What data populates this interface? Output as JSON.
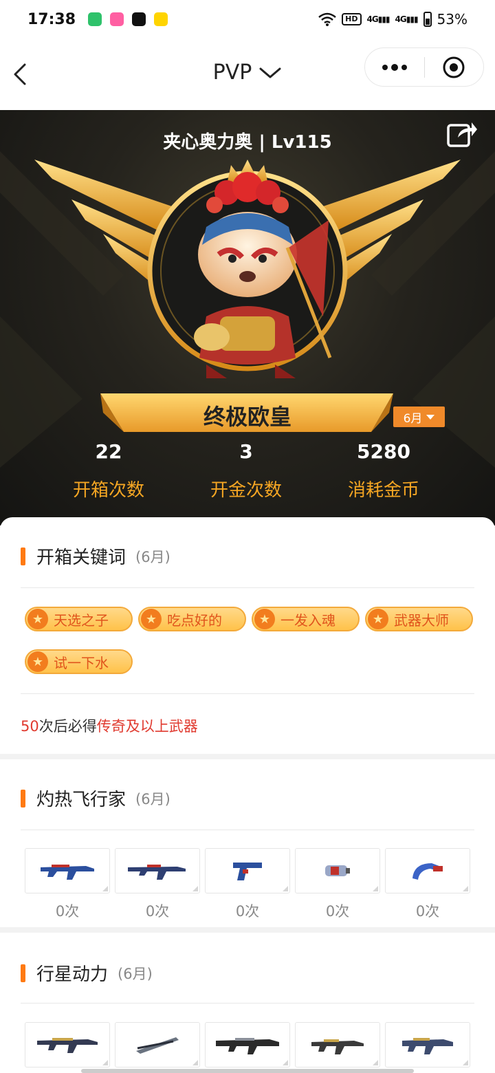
{
  "status_bar": {
    "time": "17:38",
    "hd_label": "HD",
    "signal_1": "4G",
    "signal_2": "4G",
    "battery": "53%",
    "app_icon_colors": [
      "#2fc26b",
      "#ff5fa2",
      "#111111",
      "#ffd400"
    ]
  },
  "nav": {
    "title": "PVP"
  },
  "hero": {
    "player_title": "夹心奥力奥 | Lv115",
    "rank_title": "终极欧皇",
    "month_selector": "6月",
    "stats": [
      {
        "value": "22",
        "label": "开箱次数"
      },
      {
        "value": "3",
        "label": "开金次数"
      },
      {
        "value": "5280",
        "label": "消耗金币"
      }
    ]
  },
  "keywords_section": {
    "title": "开箱关键词",
    "period": "(6月)",
    "tags": [
      "天选之子",
      "吃点好的",
      "一发入魂",
      "武器大师",
      "试一下水"
    ],
    "guarantee_count": "50",
    "guarantee_mid": "次后必得",
    "guarantee_target": "传奇及以上武器"
  },
  "sections": [
    {
      "title": "灼热飞行家",
      "period": "(6月)",
      "items": [
        {
          "icon": "rifle-icon",
          "count": "0次"
        },
        {
          "icon": "rifle-icon",
          "count": "0次"
        },
        {
          "icon": "pistol-icon",
          "count": "0次"
        },
        {
          "icon": "grenade-icon",
          "count": "0次"
        },
        {
          "icon": "karambit-icon",
          "count": "0次"
        }
      ]
    },
    {
      "title": "行星动力",
      "period": "(6月)",
      "items": [
        {
          "icon": "rifle-icon"
        },
        {
          "icon": "sword-icon"
        },
        {
          "icon": "rifle-icon"
        },
        {
          "icon": "rifle-icon"
        },
        {
          "icon": "rifle-icon"
        }
      ]
    }
  ],
  "colors": {
    "accent_orange": "#ff7a12",
    "gold": "#f5a623",
    "highlight_red": "#e03a2f"
  }
}
